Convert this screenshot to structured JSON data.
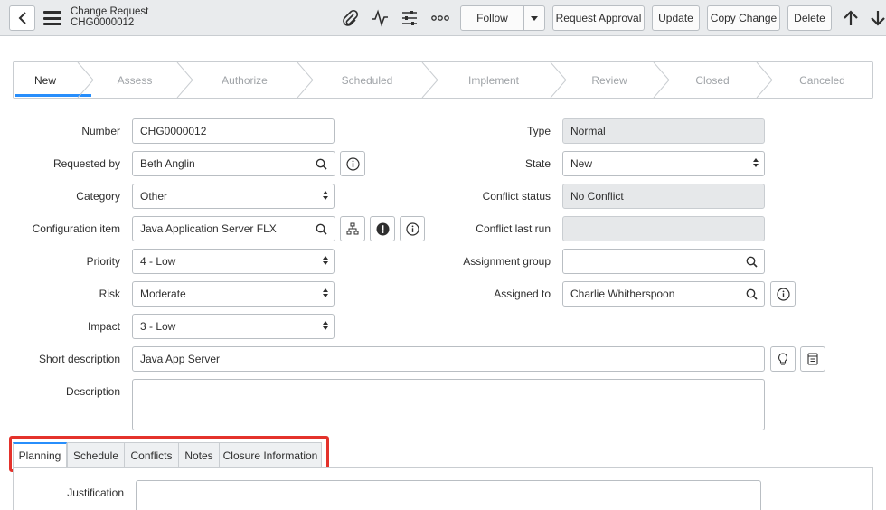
{
  "header": {
    "title": "Change Request",
    "number": "CHG0000012",
    "icons": [
      "back-icon",
      "menu-icon",
      "paperclip-icon",
      "activity-icon",
      "settings-sliders-icon",
      "more-icon",
      "arrow-up-icon",
      "arrow-down-icon"
    ],
    "follow_label": "Follow",
    "request_approval_label": "Request Approval",
    "update_label": "Update",
    "copy_change_label": "Copy Change",
    "delete_label": "Delete"
  },
  "stages": [
    {
      "label": "New",
      "active": true
    },
    {
      "label": "Assess",
      "active": false
    },
    {
      "label": "Authorize",
      "active": false
    },
    {
      "label": "Scheduled",
      "active": false
    },
    {
      "label": "Implement",
      "active": false
    },
    {
      "label": "Review",
      "active": false
    },
    {
      "label": "Closed",
      "active": false
    },
    {
      "label": "Canceled",
      "active": false
    }
  ],
  "form": {
    "left": {
      "number": {
        "label": "Number",
        "value": "CHG0000012"
      },
      "requested_by": {
        "label": "Requested by",
        "value": "Beth Anglin"
      },
      "category": {
        "label": "Category",
        "value": "Other"
      },
      "configuration_item": {
        "label": "Configuration item",
        "value": "Java Application Server FLX"
      },
      "priority": {
        "label": "Priority",
        "value": "4 - Low"
      },
      "risk": {
        "label": "Risk",
        "value": "Moderate"
      },
      "impact": {
        "label": "Impact",
        "value": "3 - Low"
      }
    },
    "right": {
      "type": {
        "label": "Type",
        "value": "Normal"
      },
      "state": {
        "label": "State",
        "value": "New"
      },
      "conflict_status": {
        "label": "Conflict status",
        "value": "No Conflict"
      },
      "conflict_last_run": {
        "label": "Conflict last run",
        "value": ""
      },
      "assignment_group": {
        "label": "Assignment group",
        "value": ""
      },
      "assigned_to": {
        "label": "Assigned to",
        "value": "Charlie Whitherspoon"
      }
    },
    "short_description": {
      "label": "Short description",
      "value": "Java App Server"
    },
    "description": {
      "label": "Description",
      "value": ""
    }
  },
  "tabs": [
    {
      "label": "Planning",
      "active": true
    },
    {
      "label": "Schedule",
      "active": false
    },
    {
      "label": "Conflicts",
      "active": false
    },
    {
      "label": "Notes",
      "active": false
    },
    {
      "label": "Closure Information",
      "active": false
    }
  ],
  "planning": {
    "justification_label": "Justification",
    "justification_value": ""
  },
  "colors": {
    "accent": "#278efc",
    "highlight": "#e4322b",
    "header_bg": "#e9ebed",
    "readonly_bg": "#e6e8ea"
  }
}
